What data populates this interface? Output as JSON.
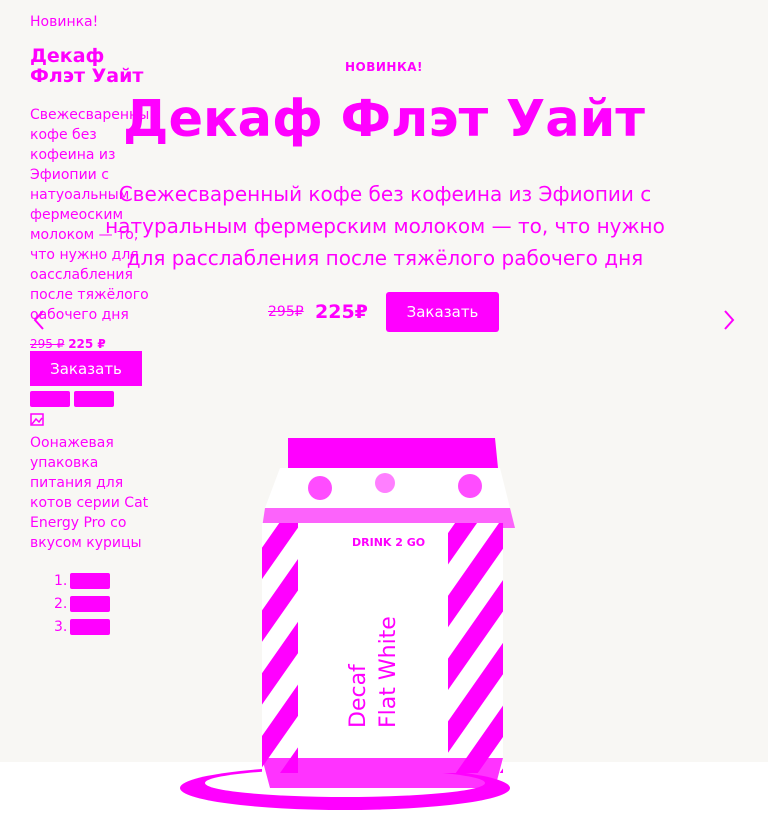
{
  "hero": {
    "kicker": "НОВИНКА!",
    "title": "Декаф Флэт Уайт",
    "description": "Свежесваренный кофе без кофеина из Эфиопии с натуральным фермерским молоком — то, что нужно для расслабления после тяжёлого рабочего дня",
    "price_old": "295₽",
    "price_new": "225₽",
    "order_label": "Заказать"
  },
  "side": {
    "kicker": "Новинка!",
    "title": "Декаф Флэт Уайт",
    "description": "Свежесваренный кофе без кофеина из Эфиопии с натуоальным фермеоским молоком — то, что нужно для оасслабления после тяжёлого оабочего дня",
    "price_old": "295 ₽",
    "price_new": "225 ₽",
    "order_label": "Заказать",
    "pack_text": "Оонажевая упаковка питания для котов серии Cat Energy Pro со вкусом курицы",
    "list": [
      "1.",
      "2.",
      "3."
    ]
  },
  "product": {
    "brand": "DRINK 2 GO",
    "name_line1": "Decaf",
    "name_line2": "Flat White"
  },
  "icons": {
    "prev": "chevron-left-icon",
    "next": "chevron-right-icon",
    "image": "broken-image-icon"
  },
  "colors": {
    "accent": "#ff00ff",
    "background": "#f8f7f4",
    "button_text": "#ffffff"
  }
}
